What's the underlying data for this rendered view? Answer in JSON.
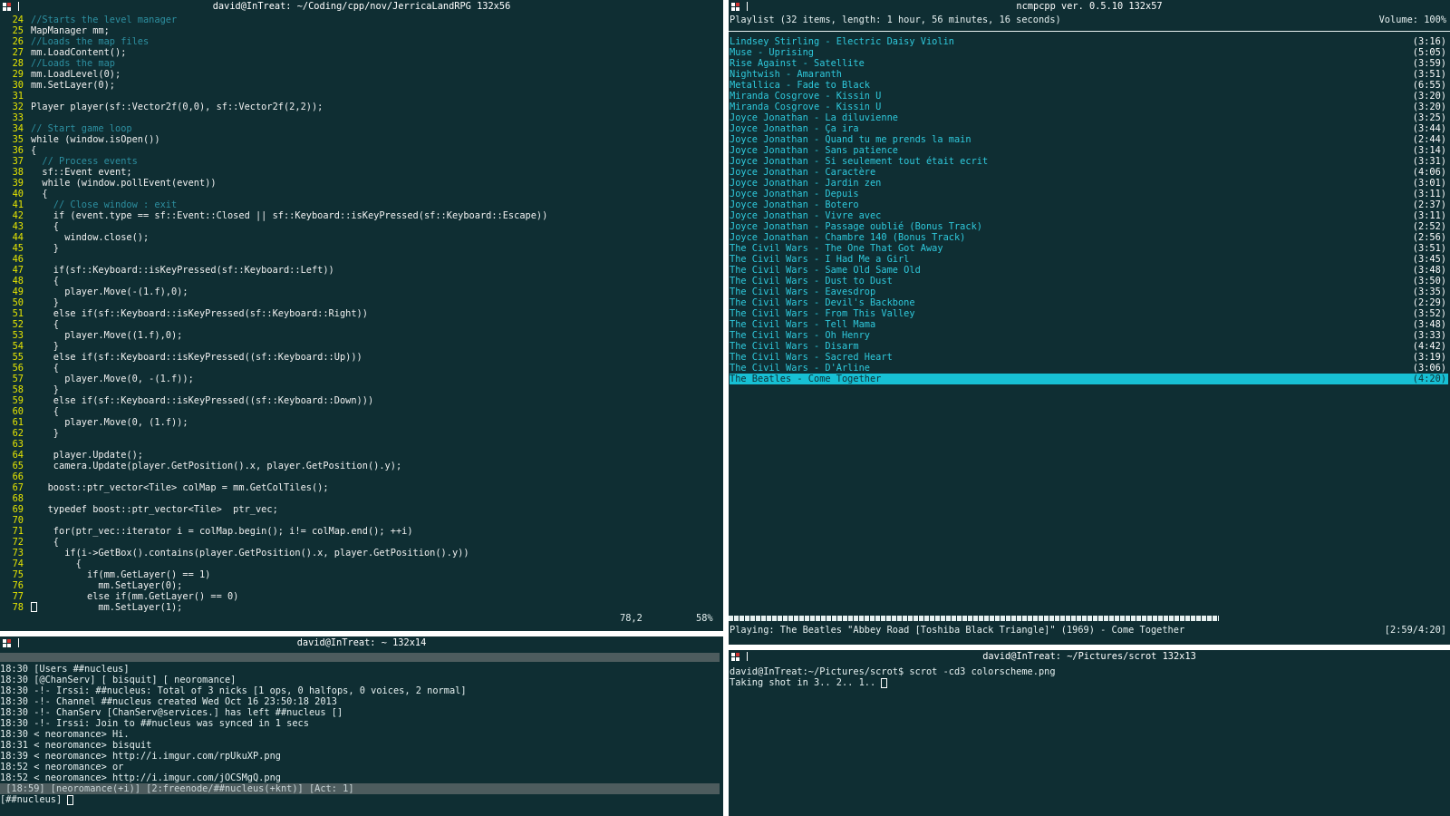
{
  "colors": {
    "accent": "#2fc9dc",
    "line_numbers": "#e6e600",
    "comment": "#2d8fa0",
    "keyword": "#36b0d8",
    "background": "#0f2e33"
  },
  "vim": {
    "title": "david@InTreat: ~/Coding/cpp/nov/JerricaLandRPG 132x56",
    "lines": [
      {
        "n": "24",
        "t": "//Starts the level manager",
        "c": "comment"
      },
      {
        "n": "25",
        "t": "MapManager mm;",
        "c": "code"
      },
      {
        "n": "26",
        "t": "//Loads the map files",
        "c": "comment"
      },
      {
        "n": "27",
        "t": "mm.LoadContent();",
        "c": "code"
      },
      {
        "n": "28",
        "t": "//Loads the map",
        "c": "comment"
      },
      {
        "n": "29",
        "t": "mm.LoadLevel(0);",
        "c": "code"
      },
      {
        "n": "30",
        "t": "mm.SetLayer(0);",
        "c": "code"
      },
      {
        "n": "31",
        "t": "",
        "c": "code"
      },
      {
        "n": "32",
        "t": "Player player(sf::Vector2f(0,0), sf::Vector2f(2,2));",
        "c": "code"
      },
      {
        "n": "33",
        "t": "",
        "c": "code"
      },
      {
        "n": "34",
        "t": "// Start game loop",
        "c": "comment"
      },
      {
        "n": "35",
        "t": "while (window.isOpen())",
        "c": "code"
      },
      {
        "n": "36",
        "t": "{",
        "c": "code"
      },
      {
        "n": "37",
        "t": "  // Process events",
        "c": "comment"
      },
      {
        "n": "38",
        "t": "  sf::Event event;",
        "c": "code"
      },
      {
        "n": "39",
        "t": "  while (window.pollEvent(event))",
        "c": "code"
      },
      {
        "n": "40",
        "t": "  {",
        "c": "code"
      },
      {
        "n": "41",
        "t": "    // Close window : exit",
        "c": "comment"
      },
      {
        "n": "42",
        "t": "    if (event.type == sf::Event::Closed || sf::Keyboard::isKeyPressed(sf::Keyboard::Escape))",
        "c": "code"
      },
      {
        "n": "43",
        "t": "    {",
        "c": "code"
      },
      {
        "n": "44",
        "t": "      window.close();",
        "c": "code"
      },
      {
        "n": "45",
        "t": "    }",
        "c": "code"
      },
      {
        "n": "46",
        "t": "",
        "c": "code"
      },
      {
        "n": "47",
        "t": "    if(sf::Keyboard::isKeyPressed(sf::Keyboard::Left))",
        "c": "code"
      },
      {
        "n": "48",
        "t": "    {",
        "c": "code"
      },
      {
        "n": "49",
        "t": "      player.Move(-(1.f),0);",
        "c": "code"
      },
      {
        "n": "50",
        "t": "    }",
        "c": "code"
      },
      {
        "n": "51",
        "t": "    else if(sf::Keyboard::isKeyPressed(sf::Keyboard::Right))",
        "c": "code"
      },
      {
        "n": "52",
        "t": "    {",
        "c": "code"
      },
      {
        "n": "53",
        "t": "      player.Move((1.f),0);",
        "c": "code"
      },
      {
        "n": "54",
        "t": "    }",
        "c": "code"
      },
      {
        "n": "55",
        "t": "    else if(sf::Keyboard::isKeyPressed((sf::Keyboard::Up)))",
        "c": "code"
      },
      {
        "n": "56",
        "t": "    {",
        "c": "code"
      },
      {
        "n": "57",
        "t": "      player.Move(0, -(1.f));",
        "c": "code"
      },
      {
        "n": "58",
        "t": "    }",
        "c": "code"
      },
      {
        "n": "59",
        "t": "    else if(sf::Keyboard::isKeyPressed((sf::Keyboard::Down)))",
        "c": "code"
      },
      {
        "n": "60",
        "t": "    {",
        "c": "code"
      },
      {
        "n": "61",
        "t": "      player.Move(0, (1.f));",
        "c": "code"
      },
      {
        "n": "62",
        "t": "    }",
        "c": "code"
      },
      {
        "n": "63",
        "t": "",
        "c": "code"
      },
      {
        "n": "64",
        "t": "    player.Update();",
        "c": "code"
      },
      {
        "n": "65",
        "t": "    camera.Update(player.GetPosition().x, player.GetPosition().y);",
        "c": "code"
      },
      {
        "n": "66",
        "t": "",
        "c": "code"
      },
      {
        "n": "67",
        "t": "   boost::ptr_vector<Tile> colMap = mm.GetColTiles();",
        "c": "code"
      },
      {
        "n": "68",
        "t": "",
        "c": "code"
      },
      {
        "n": "69",
        "t": "   typedef boost::ptr_vector<Tile>  ptr_vec;",
        "c": "code"
      },
      {
        "n": "70",
        "t": "",
        "c": "code"
      },
      {
        "n": "71",
        "t": "    for(ptr_vec::iterator i = colMap.begin(); i!= colMap.end(); ++i)",
        "c": "code"
      },
      {
        "n": "72",
        "t": "    {",
        "c": "code"
      },
      {
        "n": "73",
        "t": "      if(i->GetBox().contains(player.GetPosition().x, player.GetPosition().y))",
        "c": "code"
      },
      {
        "n": "74",
        "t": "        {",
        "c": "code"
      },
      {
        "n": "75",
        "t": "          if(mm.GetLayer() == 1)",
        "c": "code"
      },
      {
        "n": "76",
        "t": "            mm.SetLayer(0);",
        "c": "code"
      },
      {
        "n": "77",
        "t": "          else if(mm.GetLayer() == 0)",
        "c": "code"
      },
      {
        "n": "78",
        "t": "            mm.SetLayer(1);",
        "c": "code"
      }
    ],
    "status_pos": "78,2",
    "status_pct": "58%"
  },
  "irc": {
    "title": "david@InTreat: ~ 132x14",
    "lines": [
      "18:30 [Users ##nucleus]",
      "18:30 [@ChanServ] [ bisquit] [ neoromance]",
      "18:30 -!- Irssi: ##nucleus: Total of 3 nicks [1 ops, 0 halfops, 0 voices, 2 normal]",
      "18:30 -!- Channel ##nucleus created Wed Oct 16 23:50:18 2013",
      "18:30 -!- ChanServ [ChanServ@services.] has left ##nucleus []",
      "18:30 -!- Irssi: Join to ##nucleus was synced in 1 secs",
      "18:30 < neoromance> Hi.",
      "18:31 < neoromance> bisquit",
      "18:39 < neoromance> http://i.imgur.com/rpUkuXP.png",
      "18:52 < neoromance> or",
      "18:52 < neoromance> http://i.imgur.com/jOCSMgQ.png"
    ],
    "statusbar": " [18:59] [neoromance(+i)] [2:freenode/##nucleus(+knt)] [Act: 1]",
    "prompt": "[##nucleus] "
  },
  "ncmpcpp": {
    "title": "ncmpcpp ver. 0.5.10 132x57",
    "header": "Playlist (32 items, length: 1 hour, 56 minutes, 16 seconds)",
    "volume": "Volume: 100%",
    "tracks": [
      {
        "t": "Lindsey Stirling - Electric Daisy Violin",
        "d": "(3:16)"
      },
      {
        "t": "Muse - Uprising",
        "d": "(5:05)"
      },
      {
        "t": "Rise Against - Satellite",
        "d": "(3:59)"
      },
      {
        "t": "Nightwish - Amaranth",
        "d": "(3:51)"
      },
      {
        "t": "Metallica - Fade to Black",
        "d": "(6:55)"
      },
      {
        "t": "Miranda Cosgrove - Kissin U",
        "d": "(3:20)"
      },
      {
        "t": "Miranda Cosgrove - Kissin U",
        "d": "(3:20)"
      },
      {
        "t": "Joyce Jonathan - La diluvienne",
        "d": "(3:25)"
      },
      {
        "t": "Joyce Jonathan - Ça ira",
        "d": "(3:44)"
      },
      {
        "t": "Joyce Jonathan - Quand tu me prends la main",
        "d": "(2:44)"
      },
      {
        "t": "Joyce Jonathan - Sans patience",
        "d": "(3:14)"
      },
      {
        "t": "Joyce Jonathan - Si seulement tout était ecrit",
        "d": "(3:31)"
      },
      {
        "t": "Joyce Jonathan - Caractère",
        "d": "(4:06)"
      },
      {
        "t": "Joyce Jonathan - Jardin zen",
        "d": "(3:01)"
      },
      {
        "t": "Joyce Jonathan - Depuis",
        "d": "(3:11)"
      },
      {
        "t": "Joyce Jonathan - Botero",
        "d": "(2:37)"
      },
      {
        "t": "Joyce Jonathan - Vivre avec",
        "d": "(3:11)"
      },
      {
        "t": "Joyce Jonathan - Passage oublié (Bonus Track)",
        "d": "(2:52)"
      },
      {
        "t": "Joyce Jonathan - Chambre 140 (Bonus Track)",
        "d": "(2:56)"
      },
      {
        "t": "The Civil Wars - The One That Got Away",
        "d": "(3:51)"
      },
      {
        "t": "The Civil Wars - I Had Me a Girl",
        "d": "(3:45)"
      },
      {
        "t": "The Civil Wars - Same Old Same Old",
        "d": "(3:48)"
      },
      {
        "t": "The Civil Wars - Dust to Dust",
        "d": "(3:50)"
      },
      {
        "t": "The Civil Wars - Eavesdrop",
        "d": "(3:35)"
      },
      {
        "t": "The Civil Wars - Devil's Backbone",
        "d": "(2:29)"
      },
      {
        "t": "The Civil Wars - From This Valley",
        "d": "(3:52)"
      },
      {
        "t": "The Civil Wars - Tell Mama",
        "d": "(3:48)"
      },
      {
        "t": "The Civil Wars - Oh Henry",
        "d": "(3:33)"
      },
      {
        "t": "The Civil Wars - Disarm",
        "d": "(4:42)"
      },
      {
        "t": "The Civil Wars - Sacred Heart",
        "d": "(3:19)"
      },
      {
        "t": "The Civil Wars - D'Arline",
        "d": "(3:06)"
      },
      {
        "t": "The Beatles - Come Together",
        "d": "(4:20)"
      }
    ],
    "selected_index": 31,
    "progress": 0.68,
    "now_playing": "Playing: The Beatles \"Abbey Road [Toshiba Black Triangle]\" (1969) - Come Together",
    "time": "[2:59/4:20]"
  },
  "scrot": {
    "title": "david@InTreat: ~/Pictures/scrot 132x13",
    "lines": [
      "david@InTreat:~/Pictures/scrot$ scrot -cd3 colorscheme.png",
      "Taking shot in 3.. 2.. 1.. "
    ]
  }
}
